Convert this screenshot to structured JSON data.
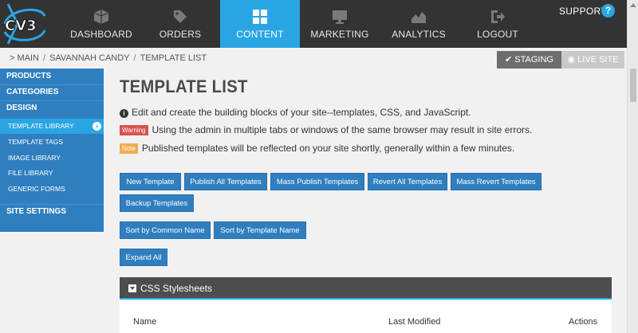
{
  "app": {
    "logo_text": "CV3"
  },
  "nav": [
    {
      "label": "DASHBOARD",
      "icon": "cube-icon",
      "active": false
    },
    {
      "label": "ORDERS",
      "icon": "tags-icon",
      "active": false
    },
    {
      "label": "CONTENT",
      "icon": "grid-icon",
      "active": true
    },
    {
      "label": "MARKETING",
      "icon": "monitor-icon",
      "active": false
    },
    {
      "label": "ANALYTICS",
      "icon": "area-chart-icon",
      "active": false
    },
    {
      "label": "LOGOUT",
      "icon": "logout-icon",
      "active": false
    }
  ],
  "support": {
    "label": "SUPPORT",
    "icon": "question-icon"
  },
  "breadcrumb": {
    "prefix": ">",
    "items": [
      "MAIN",
      "SAVANNAH CANDY",
      "TEMPLATE LIST"
    ]
  },
  "env": {
    "staging": "STAGING",
    "live": "LIVE SITE"
  },
  "sidebar": {
    "products": "PRODUCTS",
    "categories": "CATEGORIES",
    "design": "DESIGN",
    "items": [
      "TEMPLATE LIBRARY",
      "TEMPLATE TAGS",
      "IMAGE LIBRARY",
      "FILE LIBRARY",
      "GENERIC FORMS"
    ],
    "active_item": "TEMPLATE LIBRARY",
    "site_settings": "SITE SETTINGS"
  },
  "page": {
    "title": "TEMPLATE LIST",
    "info": "Edit and create the building blocks of your site--templates, CSS, and JavaScript.",
    "warning_tag": "Warning",
    "warning": "Using the admin in multiple tabs or windows of the same browser may result in site errors.",
    "note_tag": "Note",
    "note": "Published templates will be reflected on your site shortly, generally within a few minutes."
  },
  "buttons": {
    "new_template": "New Template",
    "publish_all": "Publish All Templates",
    "mass_publish": "Mass Publish Templates",
    "revert_all": "Revert All Templates",
    "mass_revert": "Mass Revert Templates",
    "backup": "Backup Templates",
    "sort_common": "Sort by Common Name",
    "sort_template": "Sort by Template Name",
    "expand_all": "Expand All"
  },
  "panel": {
    "title": "CSS Stylesheets",
    "columns": [
      "Name",
      "Last Modified",
      "Actions"
    ]
  },
  "colors": {
    "accent": "#2aa5e4",
    "sidebar": "#2f7fc0",
    "topbar": "#333333",
    "warning": "#d9534f",
    "note": "#f0ad4e"
  }
}
